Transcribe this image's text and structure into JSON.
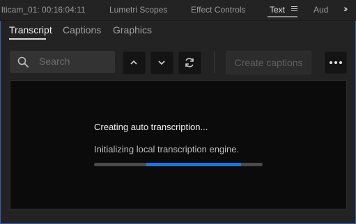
{
  "panel_tabs": [
    {
      "label": "lticam_01: 00:16:04:11",
      "active": false
    },
    {
      "label": "Lumetri Scopes",
      "active": false
    },
    {
      "label": "Effect Controls",
      "active": false
    },
    {
      "label": "Text",
      "active": true
    },
    {
      "label": "Aud",
      "active": false
    }
  ],
  "sub_tabs": [
    {
      "label": "Transcript",
      "active": true
    },
    {
      "label": "Captions",
      "active": false
    },
    {
      "label": "Graphics",
      "active": false
    }
  ],
  "search": {
    "placeholder": "Search"
  },
  "toolbar": {
    "create_captions_label": "Create captions"
  },
  "status": {
    "title": "Creating auto transcription...",
    "message": "Initializing local transcription engine.",
    "progress": {
      "start_fraction": 0.31,
      "end_fraction": 0.87
    }
  },
  "colors": {
    "accent": "#1f74e0",
    "frame": "#3a5fa8"
  },
  "icons": [
    "menu-icon",
    "chevron-right-double-icon",
    "search-icon",
    "chevron-up-icon",
    "chevron-down-icon",
    "sync-icon",
    "ellipsis-icon"
  ]
}
